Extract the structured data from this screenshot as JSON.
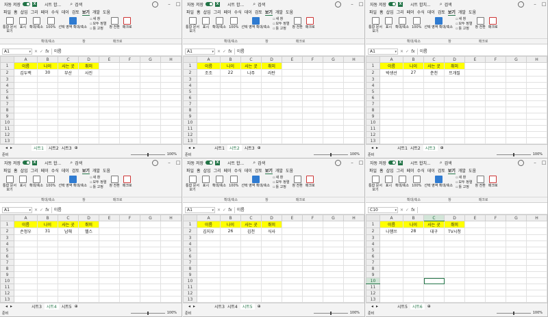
{
  "common": {
    "autosave": "자동 저장",
    "search": "검색",
    "menus": [
      "파일",
      "홈",
      "삽입",
      "그리",
      "페이",
      "수식",
      "데이",
      "검토",
      "보기",
      "개발",
      "도움"
    ],
    "active_menu": "보기",
    "ribbon": {
      "integrated_doc": "통합 문서",
      "view": "보기",
      "display": "표시",
      "zoom": "확대/축소",
      "zoom100": "100%",
      "zoom_selection": "선택 영역 확대/축소",
      "new_window": "새 창",
      "arrange_all": "모두 정렬",
      "freeze": "틀 고정",
      "switch_window": "창 전환",
      "macro": "매크로",
      "group_zoom": "확대/축소",
      "group_window": "창",
      "group_macro": "매크로"
    },
    "fx": "fx",
    "headers": [
      "이름",
      "나이",
      "사는 곳",
      "취미"
    ],
    "col_letters": [
      "A",
      "B",
      "C",
      "D",
      "E",
      "F",
      "G",
      "H"
    ],
    "ready": "준비",
    "zoom_pct": "100%"
  },
  "windows": [
    {
      "title": "시트 합...",
      "namebox": "A1",
      "formula": "이름",
      "row": [
        "김두백",
        "30",
        "부산",
        "사진"
      ],
      "tabs": [
        "시트1",
        "시트2",
        "시트3"
      ],
      "active_tab": "시트1"
    },
    {
      "title": "시트 합...",
      "namebox": "A1",
      "formula": "이름",
      "row": [
        "조조",
        "22",
        "나주",
        "라탄"
      ],
      "tabs": [
        "시트1",
        "시트2",
        "시트3"
      ],
      "active_tab": "시트2"
    },
    {
      "title": "시트 합치...",
      "namebox": "A1",
      "formula": "이름",
      "row": [
        "박생선",
        "27",
        "춘천",
        "뜨개질"
      ],
      "tabs": [
        "시트1",
        "시트2",
        "시트3"
      ],
      "active_tab": "시트3"
    },
    {
      "title": "시트 합...",
      "namebox": "A1",
      "formula": "이름",
      "row": [
        "손정우",
        "31",
        "남해",
        "헬스"
      ],
      "tabs": [
        "시트3",
        "시트4",
        "시트5"
      ],
      "active_tab": "시트4"
    },
    {
      "title": "시트 합...",
      "namebox": "A1",
      "formula": "이름",
      "row": [
        "김지우",
        "26",
        "김천",
        "식사"
      ],
      "tabs": [
        "시트3",
        "시트4",
        "시트5"
      ],
      "active_tab": "시트5"
    },
    {
      "title": "시트 합치...",
      "namebox": "C10",
      "formula": "",
      "row": [
        "나햄쓰",
        "28",
        "대구",
        "TV시청"
      ],
      "tabs": [
        "시트5",
        "시트6"
      ],
      "active_tab": "시트6"
    }
  ]
}
